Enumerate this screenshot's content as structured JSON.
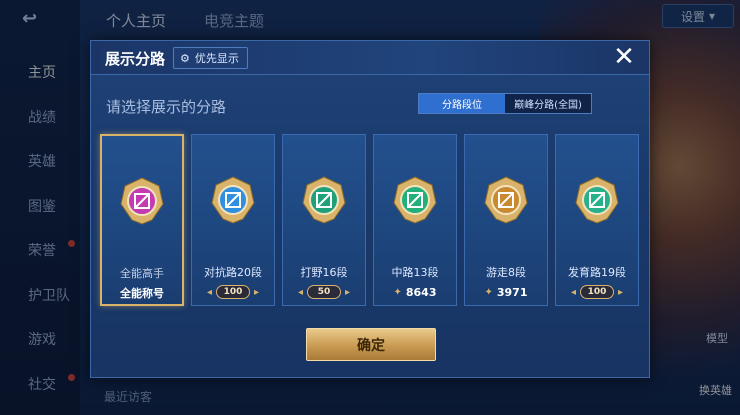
{
  "background": {
    "top_tabs": [
      "个人主页",
      "电竞主题"
    ],
    "settings_label": "设置",
    "side_menu": [
      {
        "label": "主页",
        "active": true,
        "dot": false
      },
      {
        "label": "战绩",
        "active": false,
        "dot": false
      },
      {
        "label": "英雄",
        "active": false,
        "dot": false
      },
      {
        "label": "图鉴",
        "active": false,
        "dot": false
      },
      {
        "label": "荣誉",
        "active": false,
        "dot": true
      },
      {
        "label": "护卫队",
        "active": false,
        "dot": false
      },
      {
        "label": "游戏",
        "active": false,
        "dot": false
      },
      {
        "label": "社交",
        "active": false,
        "dot": true
      }
    ],
    "recent_text": "最近访客",
    "tag_label": "模型",
    "hero_btn_label": "换英雄"
  },
  "modal": {
    "title": "展示分路",
    "priority_label": "优先显示",
    "close_icon": "close-icon",
    "subtitle": "请选择展示的分路",
    "toggle": [
      {
        "label": "分路段位",
        "active": true
      },
      {
        "label": "巅峰分路(全国)",
        "active": false
      }
    ],
    "cards": [
      {
        "name": "全能高手",
        "foot_type": "title",
        "foot_text": "全能称号",
        "selected": true,
        "emblem_color": "#c23bb0"
      },
      {
        "name": "对抗路20段",
        "foot_type": "level",
        "foot_text": "100",
        "selected": false,
        "emblem_color": "#2f8fe0"
      },
      {
        "name": "打野16段",
        "foot_type": "level",
        "foot_text": "50",
        "selected": false,
        "emblem_color": "#1fa07a"
      },
      {
        "name": "中路13段",
        "foot_type": "score",
        "foot_text": "8643",
        "selected": false,
        "emblem_color": "#22b07a"
      },
      {
        "name": "游走8段",
        "foot_type": "score",
        "foot_text": "3971",
        "selected": false,
        "emblem_color": "#c9892e"
      },
      {
        "name": "发育路19段",
        "foot_type": "level",
        "foot_text": "100",
        "selected": false,
        "emblem_color": "#28b08a"
      }
    ],
    "confirm_label": "确定"
  },
  "colors": {
    "accent_gold": "#d9b36a",
    "toggle_active": "#2f6fd0",
    "panel_bg": "#1a3a6c"
  }
}
